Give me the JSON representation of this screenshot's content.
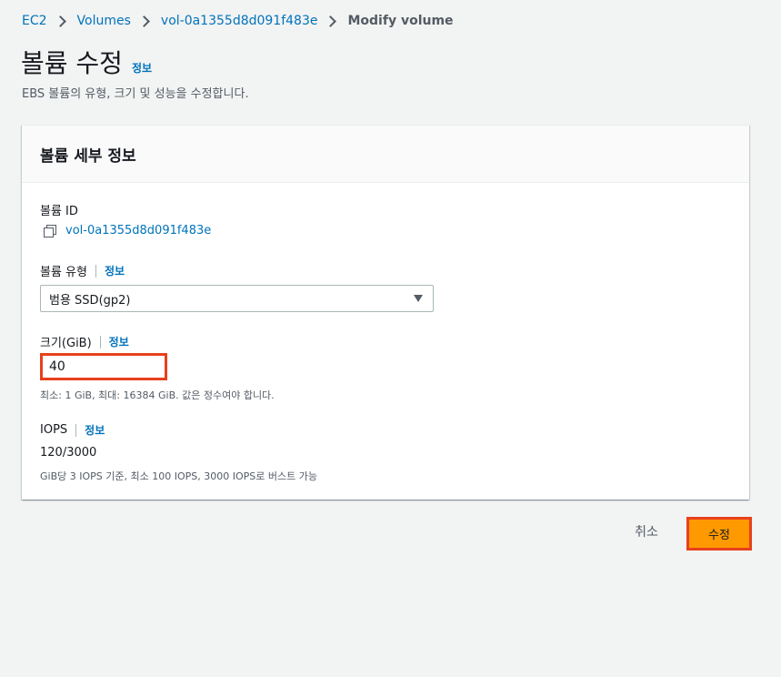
{
  "breadcrumb": {
    "items": [
      "EC2",
      "Volumes",
      "vol-0a1355d8d091f483e"
    ],
    "current": "Modify volume"
  },
  "page": {
    "title": "볼륨 수정",
    "info": "정보",
    "description": "EBS 볼륨의 유형, 크기 및 성능을 수정합니다."
  },
  "panel": {
    "title": "볼륨 세부 정보",
    "volume_id_label": "볼륨 ID",
    "volume_id": "vol-0a1355d8d091f483e",
    "volume_type_label": "볼륨 유형",
    "volume_type_info": "정보",
    "volume_type_value": "범용 SSD(gp2)",
    "size_label": "크기(GiB)",
    "size_info": "정보",
    "size_value": "40",
    "size_hint": "최소: 1 GiB, 최대: 16384 GiB. 값은 정수여야 합니다.",
    "iops_label": "IOPS",
    "iops_info": "정보",
    "iops_value": "120/3000",
    "iops_hint": "GiB당 3 IOPS 기준, 최소 100 IOPS, 3000 IOPS로 버스트 가능"
  },
  "actions": {
    "cancel": "취소",
    "submit": "수정"
  },
  "colors": {
    "link": "#0073bb",
    "primary_button": "#ff9900",
    "highlight": "#e8401c"
  }
}
